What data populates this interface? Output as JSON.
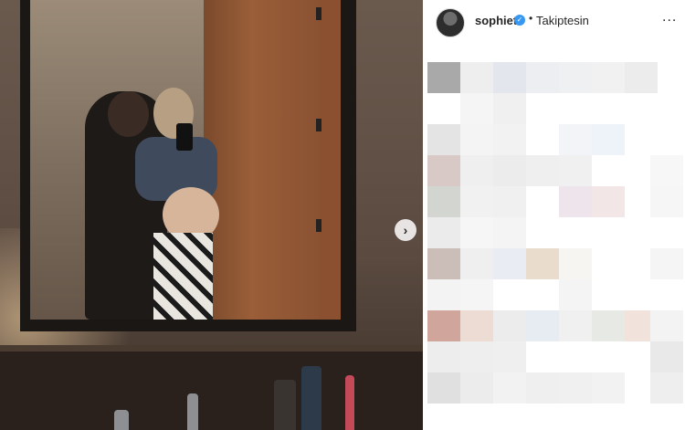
{
  "header": {
    "username": "sophiet",
    "verified_icon": "verified-badge-icon",
    "separator": "•",
    "follow_label": "Takiptesin",
    "more_label": "..."
  },
  "carousel": {
    "next_icon": "chevron-right-icon",
    "next_glyph": "›"
  },
  "colors": {
    "verified": "#3897f0",
    "text": "#262626"
  }
}
